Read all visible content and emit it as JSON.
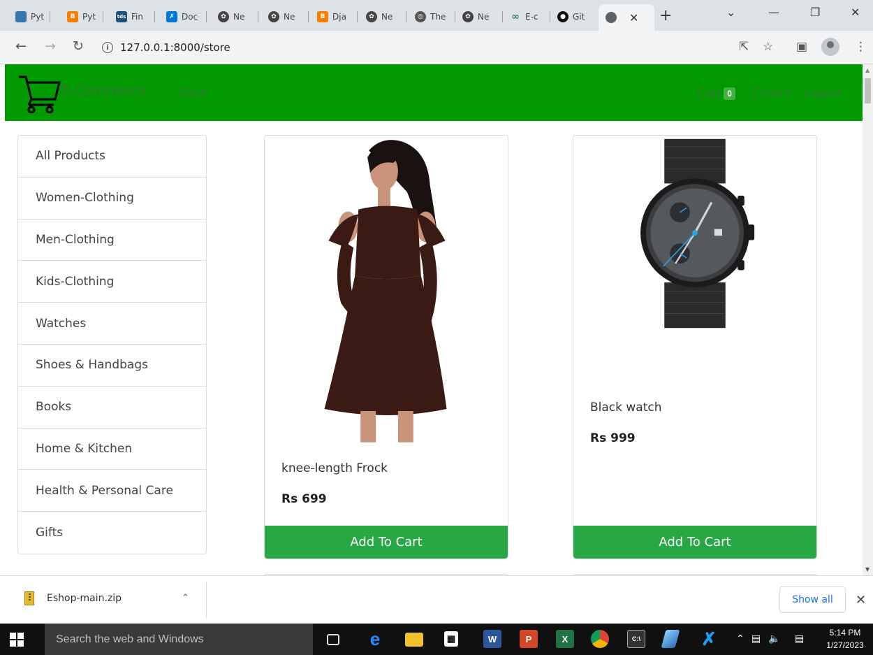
{
  "browser": {
    "tabs": [
      {
        "label": "Pyt",
        "icon": "python-icon",
        "color": "#3776ab"
      },
      {
        "label": "Pyt",
        "icon": "blogger-icon",
        "color": "#f57d00"
      },
      {
        "label": "Fin",
        "icon": "tds-icon",
        "color": "#1f4e79"
      },
      {
        "label": "Doc",
        "icon": "vscode-icon",
        "color": "#0078d7"
      },
      {
        "label": "Ne",
        "icon": "openai-icon",
        "color": "#444444"
      },
      {
        "label": "Ne",
        "icon": "openai-icon",
        "color": "#444444"
      },
      {
        "label": "Dja",
        "icon": "blogger-icon",
        "color": "#f57d00"
      },
      {
        "label": "Ne",
        "icon": "openai-icon",
        "color": "#444444"
      },
      {
        "label": "The",
        "icon": "globe-icon",
        "color": "#555555"
      },
      {
        "label": "Ne",
        "icon": "openai-icon",
        "color": "#444444"
      },
      {
        "label": "E-c",
        "icon": "infinity-icon",
        "color": "#2e8b57"
      },
      {
        "label": "Git",
        "icon": "github-icon",
        "color": "#111111"
      }
    ],
    "url": "127.0.0.1:8000/store"
  },
  "navbar": {
    "brand": "E-Commerce",
    "store_link": "Store",
    "cart_label": "Cart",
    "cart_count": "0",
    "orders_link": "Orders",
    "logout_link": "Logout",
    "bg_color": "#009900"
  },
  "categories": [
    "All Products",
    "Women-Clothing",
    "Men-Clothing",
    "Kids-Clothing",
    "Watches",
    "Shoes & Handbags",
    "Books",
    "Home & Kitchen",
    "Health & Personal Care",
    "Gifts"
  ],
  "products": [
    {
      "name": "knee-length Frock",
      "price": "Rs 699",
      "button": "Add To Cart",
      "image": "dress-image"
    },
    {
      "name": "Black watch",
      "price": "Rs 999",
      "button": "Add To Cart",
      "image": "watch-image"
    }
  ],
  "download_bar": {
    "filename": "Eshop-main.zip",
    "show_all": "Show all"
  },
  "taskbar": {
    "search_placeholder": "Search the web and Windows",
    "time": "5:14 PM",
    "date": "1/27/2023"
  }
}
